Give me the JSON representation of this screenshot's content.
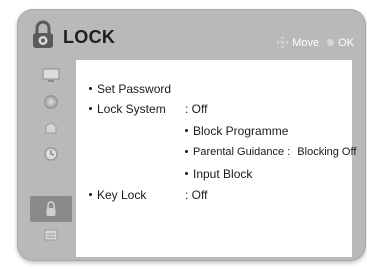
{
  "menu": {
    "title": "LOCK",
    "hints": {
      "move_label": "Move",
      "ok_label": "OK"
    }
  },
  "sidebar": {
    "items": [
      {
        "icon": "picture-icon",
        "active": false
      },
      {
        "icon": "audio-icon",
        "active": false
      },
      {
        "icon": "setup-icon",
        "active": false
      },
      {
        "icon": "time-icon",
        "active": false
      },
      {
        "icon": "lock-icon",
        "active": true
      },
      {
        "icon": "option-icon",
        "active": false
      }
    ]
  },
  "lock_menu": {
    "set_password": {
      "label": "Set Password"
    },
    "lock_system": {
      "label": "Lock System",
      "value": ": Off"
    },
    "block_programme": {
      "label": "Block Programme"
    },
    "parental_guidance": {
      "label": "Parental Guidance :",
      "value": "Blocking Off"
    },
    "input_block": {
      "label": "Input Block"
    },
    "key_lock": {
      "label": "Key Lock",
      "value": ": Off"
    }
  },
  "colors": {
    "frame": "#b9b9b9",
    "active_item": "#8a8a8a",
    "panel": "#ffffff",
    "text": "#1a1a1a"
  }
}
